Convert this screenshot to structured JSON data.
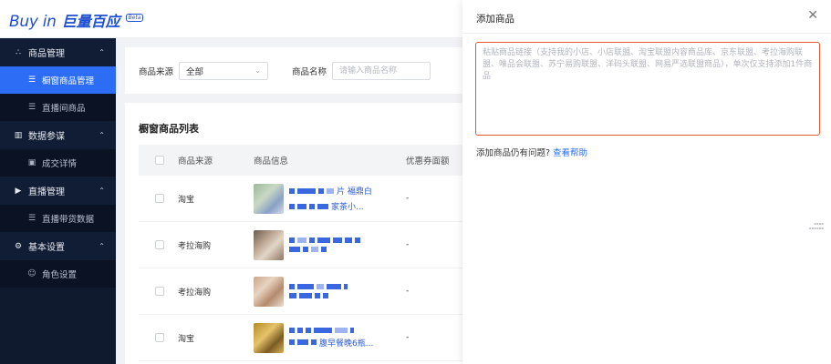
{
  "header": {
    "logo_buyin": "Buy in",
    "logo_cn": "巨量百应",
    "logo_beta": "Beta"
  },
  "sidebar": {
    "groups": [
      {
        "label": "商品管理",
        "icon": "product-icon",
        "items": [
          {
            "label": "橱窗商品管理",
            "active": true
          },
          {
            "label": "直播间商品",
            "active": false
          }
        ]
      },
      {
        "label": "数据参谋",
        "icon": "chart-icon",
        "items": [
          {
            "label": "成交详情",
            "active": false
          }
        ]
      },
      {
        "label": "直播管理",
        "icon": "video-icon",
        "items": [
          {
            "label": "直播带货数据",
            "active": false
          }
        ]
      },
      {
        "label": "基本设置",
        "icon": "gear-icon",
        "items": [
          {
            "label": "角色设置",
            "active": false
          }
        ]
      }
    ]
  },
  "filter": {
    "source_label": "商品来源",
    "source_value": "全部",
    "name_label": "商品名称",
    "name_placeholder": "请输入商品名称"
  },
  "list": {
    "title": "橱窗商品列表",
    "columns": [
      "商品来源",
      "商品信息",
      "优惠券面额"
    ],
    "rows": [
      {
        "source": "淘宝",
        "title_line1": "片 福鼎白",
        "title_line2": "家茶小...",
        "coupon": "-"
      },
      {
        "source": "考拉海购",
        "title_line1": "",
        "title_line2": "",
        "coupon": "-"
      },
      {
        "source": "考拉海购",
        "title_line1": "",
        "title_line2": "",
        "coupon": "-"
      },
      {
        "source": "淘宝",
        "title_line1": "",
        "title_line2": "腹早餐晚6瓶...",
        "coupon": "-"
      }
    ]
  },
  "drawer": {
    "title": "添加商品",
    "textarea_placeholder": "粘贴商品链接（支持我的小店、小店联盟、淘宝联盟内容商品库、京东联盟、考拉海购联盟、唯品会联盟、苏宁易购联盟、洋码头联盟、网易严选联盟商品），单次仅支持添加1件商品",
    "help_text": "添加商品仍有问题?",
    "help_link": "查看帮助"
  },
  "colors": {
    "accent": "#2d6df6",
    "sidebar_bg": "#0f1a2f",
    "textarea_border": "#e05a2e"
  }
}
